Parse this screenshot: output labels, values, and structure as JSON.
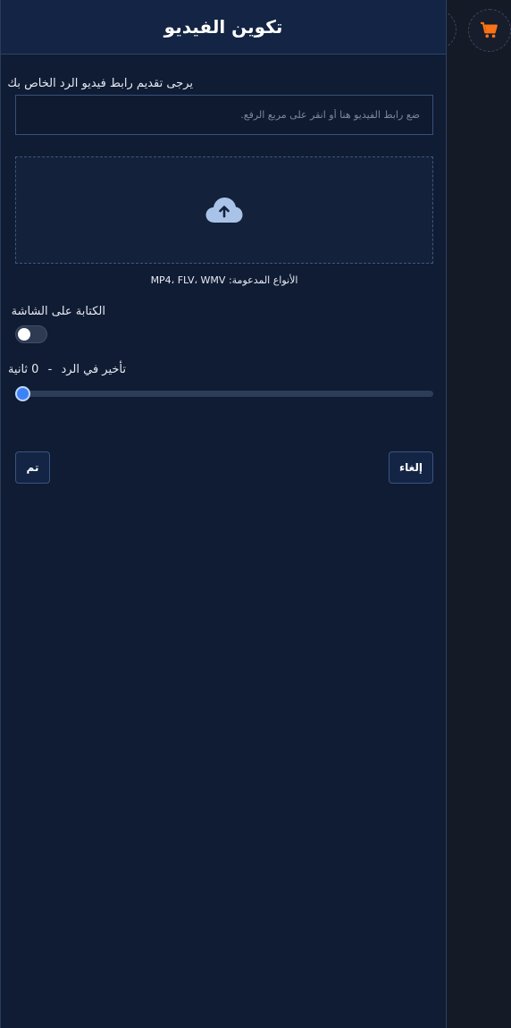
{
  "dialog": {
    "title": "تكوين الفيديو"
  },
  "video_url": {
    "label": "يرجى تقديم رابط فيديو الرد الخاص بك",
    "placeholder": "ضع رابط الفيديو هنا أو انقر على مربع الرفع.",
    "value": ""
  },
  "upload": {
    "icon": "cloud-upload-icon",
    "supported_formats": "الأنواع المدعومة: MP4، FLV، WMV"
  },
  "screen_text": {
    "label": "الكتابة على الشاشة",
    "enabled": false
  },
  "delay": {
    "label": "تأخير في الرد",
    "separator": "-",
    "value": "0",
    "unit": "ثانية",
    "slider_fraction": 0
  },
  "buttons": {
    "done": "تم",
    "cancel": "إلغاء"
  },
  "background": {
    "cart_icon": "shopping-cart-icon"
  },
  "colors": {
    "accent": "#3b82f6",
    "cart": "#f97316",
    "panel_bg": "#101c33"
  }
}
